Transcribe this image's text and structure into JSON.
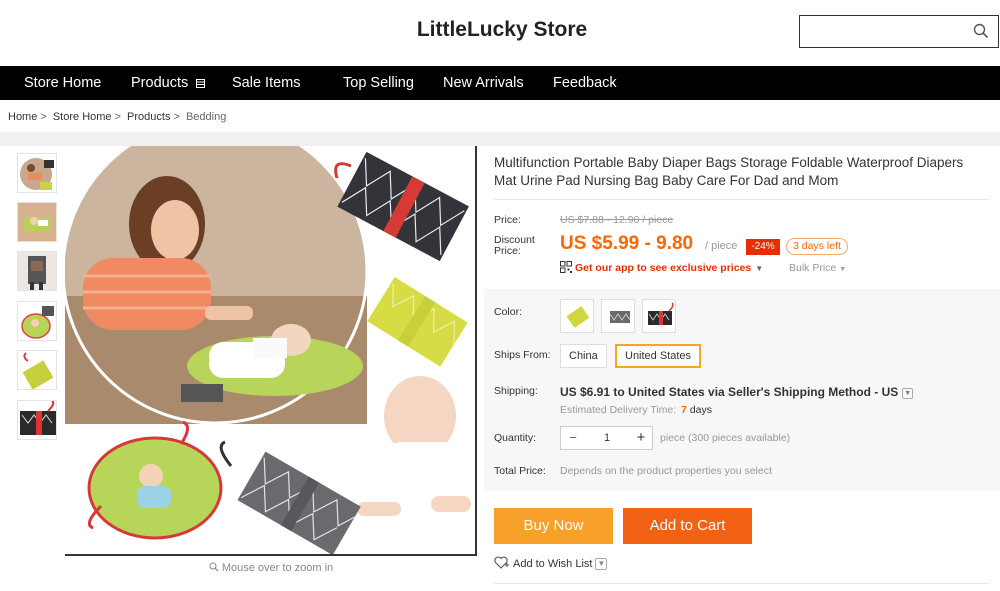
{
  "store": {
    "name": "LittleLucky Store",
    "search_placeholder": ""
  },
  "nav": {
    "items": [
      "Store Home",
      "Products",
      "Sale Items",
      "Top Selling",
      "New Arrivals",
      "Feedback"
    ]
  },
  "breadcrumb": [
    "Home",
    "Store Home",
    "Products",
    "Bedding"
  ],
  "gallery": {
    "zoom_hint": "Mouse over to zoom in"
  },
  "product": {
    "title": "Multifunction Portable Baby Diaper Bags Storage Foldable Waterproof Diapers Mat Urine Pad Nursing Bag Baby Care For Dad and Mom",
    "price_label": "Price:",
    "original_price": "US $7.88 - 12.90 / piece",
    "discount_label_1": "Discount",
    "discount_label_2": "Price:",
    "discount_price": "US $5.99 - 9.80",
    "per_piece": "/ piece",
    "discount_badge": "-24%",
    "days_left": "3 days left",
    "app_promo": "Get our app to see exclusive prices",
    "bulk_price": "Bulk Price",
    "color_label": "Color:",
    "ships_from_label": "Ships From:",
    "ships_from_options": [
      "China",
      "United States"
    ],
    "ships_from_selected": "United States",
    "shipping_label": "Shipping:",
    "shipping_text": "US $6.91 to United States via Seller's Shipping Method - US",
    "delivery_label": "Estimated Delivery Time:",
    "delivery_days": "7",
    "delivery_unit": "days",
    "quantity_label": "Quantity:",
    "quantity_value": "1",
    "quantity_note": "piece (300 pieces available)",
    "total_label": "Total Price:",
    "total_note": "Depends on the product properties you select",
    "buy_now": "Buy Now",
    "add_to_cart": "Add to Cart",
    "wish_list": "Add to Wish List"
  },
  "colors": {
    "accent_orange": "#ff6600",
    "buy_now": "#f7a02a",
    "add_to_cart": "#f26214",
    "badge_red": "#e62e04",
    "nav_bg": "#000000"
  }
}
